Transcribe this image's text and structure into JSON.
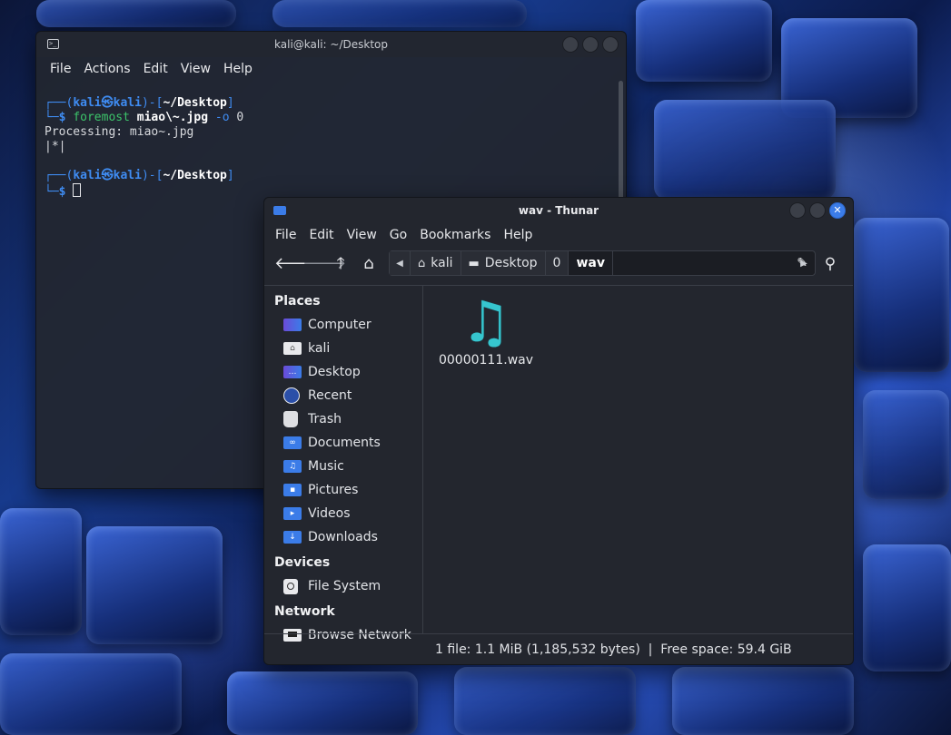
{
  "terminal": {
    "title": "kali@kali: ~/Desktop",
    "menu": [
      "File",
      "Actions",
      "Edit",
      "View",
      "Help"
    ],
    "prompt_user": "kali",
    "prompt_host": "kali",
    "prompt_at": "㉿",
    "prompt_dir": "~/Desktop",
    "command_name": "foremost",
    "command_arg1": "miao\\~.jpg",
    "command_flag": "-o",
    "command_arg2": "0",
    "output_line1": "Processing: miao~.jpg",
    "output_line2": "|*|"
  },
  "thunar": {
    "title": "wav - Thunar",
    "menu": [
      "File",
      "Edit",
      "View",
      "Go",
      "Bookmarks",
      "Help"
    ],
    "breadcrumbs": [
      "kali",
      "Desktop",
      "0",
      "wav"
    ],
    "sidebar": {
      "places_header": "Places",
      "places": [
        "Computer",
        "kali",
        "Desktop",
        "Recent",
        "Trash",
        "Documents",
        "Music",
        "Pictures",
        "Videos",
        "Downloads"
      ],
      "devices_header": "Devices",
      "devices": [
        "File System"
      ],
      "network_header": "Network",
      "network": [
        "Browse Network"
      ]
    },
    "files": [
      {
        "name": "00000111.wav",
        "icon": "audio-file-icon"
      }
    ],
    "status": "1 file: 1.1 MiB (1,185,532 bytes)  |  Free space: 59.4 GiB"
  },
  "colors": {
    "accent_blue": "#3b7ce8",
    "prompt_blue": "#3f8cf2",
    "prompt_green": "#3cc46a",
    "audio_teal": "#36c6cf"
  }
}
